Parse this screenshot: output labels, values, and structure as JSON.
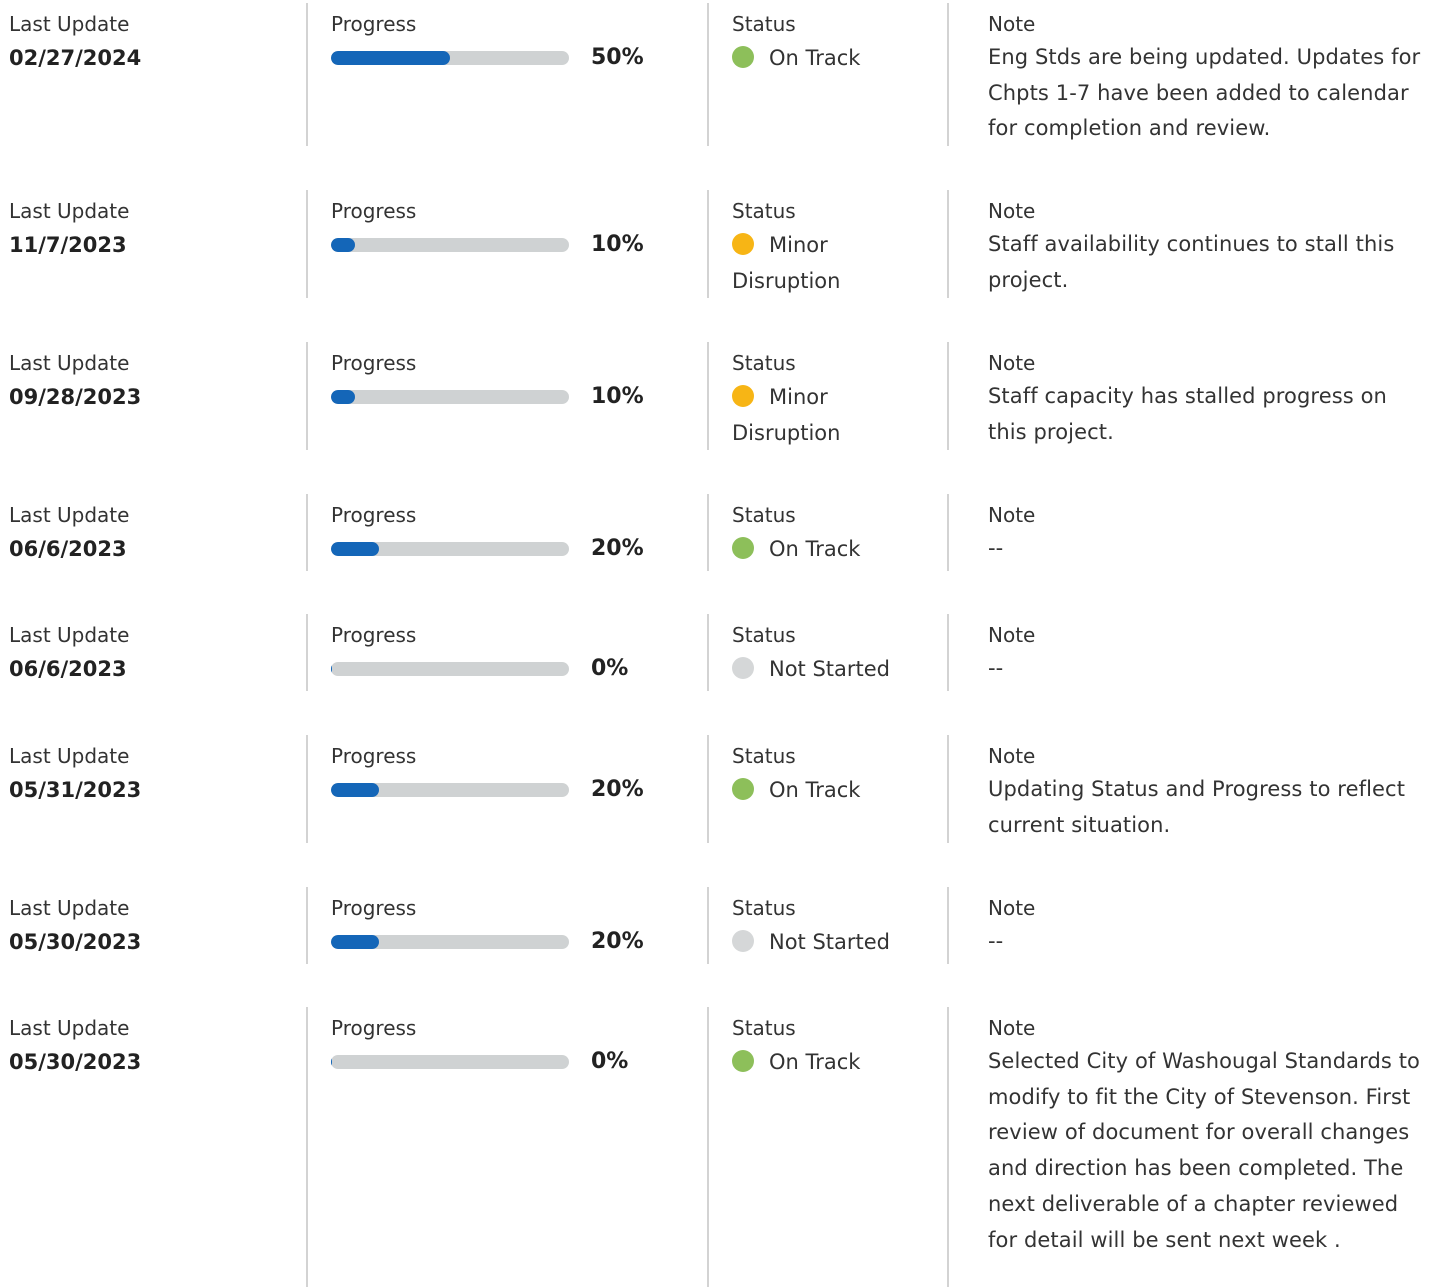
{
  "labels": {
    "last_update": "Last Update",
    "progress": "Progress",
    "status": "Status",
    "note": "Note"
  },
  "status_colors": {
    "On Track": "#8dbf5a",
    "Minor Disruption": "#f7b515",
    "Not Started": "#d5d7d8"
  },
  "progress_colors": {
    "fill": "#1466b8",
    "track": "#cfd2d3"
  },
  "updates": [
    {
      "date": "02/27/2024",
      "progress": 50,
      "progress_label": "50%",
      "status": "On Track",
      "note": "Eng Stds are being updated. Updates for Chpts 1-7 have been added to calendar for completion and review."
    },
    {
      "date": "11/7/2023",
      "progress": 10,
      "progress_label": "10%",
      "status": "Minor Disruption",
      "note": "Staff availability continues to stall this project."
    },
    {
      "date": "09/28/2023",
      "progress": 10,
      "progress_label": "10%",
      "status": "Minor Disruption",
      "note": "Staff capacity has stalled progress on this project."
    },
    {
      "date": "06/6/2023",
      "progress": 20,
      "progress_label": "20%",
      "status": "On Track",
      "note": "--"
    },
    {
      "date": "06/6/2023",
      "progress": 0,
      "progress_label": "0%",
      "status": "Not Started",
      "note": "--"
    },
    {
      "date": "05/31/2023",
      "progress": 20,
      "progress_label": "20%",
      "status": "On Track",
      "note": "Updating Status and Progress to reflect current situation."
    },
    {
      "date": "05/30/2023",
      "progress": 20,
      "progress_label": "20%",
      "status": "Not Started",
      "note": "--"
    },
    {
      "date": "05/30/2023",
      "progress": 0,
      "progress_label": "0%",
      "status": "On Track",
      "note": "Selected City of Washougal Standards to modify to fit the City of Stevenson. First review of document for overall changes and direction has been completed. The next deliverable of a chapter reviewed for detail will be sent next week ."
    }
  ]
}
